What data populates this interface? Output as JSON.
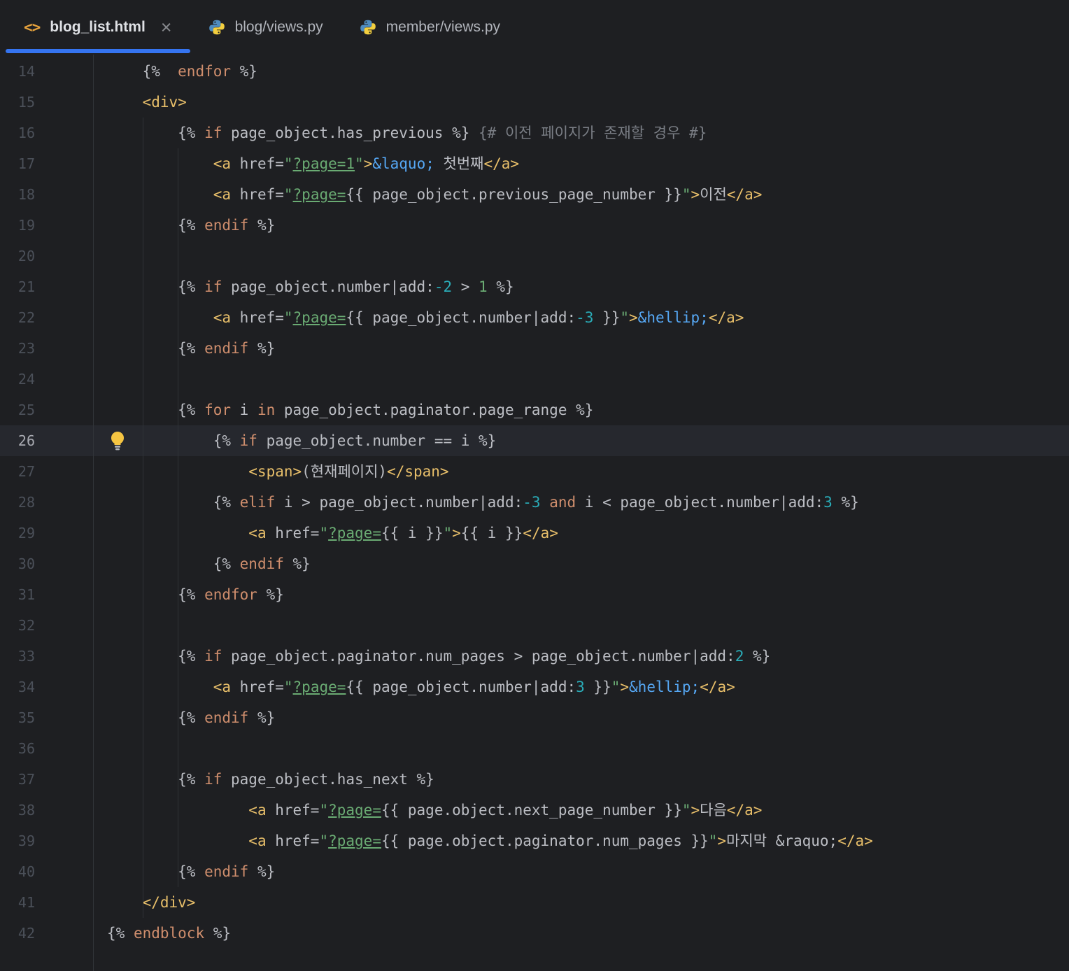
{
  "colors": {
    "bg": "#1e1f22",
    "accent": "#3574f0",
    "current_line": "#26282e",
    "gutter_line": "#313438",
    "indent_guide": "#2f3237",
    "line_number": "#4b5059",
    "line_number_active": "#a9abb2",
    "plain": "#bcbec4",
    "keyword": "#cf8e6d",
    "tag": "#e8bf6a",
    "string": "#6aab73",
    "entity": "#56a8f5",
    "number": "#2aacb8",
    "comment": "#7a7e85",
    "tab_active": "#dfe1e5",
    "tab_inactive": "#b2b5bc",
    "close_icon": "#87898e",
    "html_icon": "#e8a33d",
    "bulb": "#f5c542"
  },
  "icons": {
    "html_glyph": "<>",
    "close_glyph": "×"
  },
  "tabs": [
    {
      "label": "blog_list.html",
      "icon": "html",
      "active": true
    },
    {
      "label": "blog/views.py",
      "icon": "python",
      "active": false
    },
    {
      "label": "member/views.py",
      "icon": "python",
      "active": false
    }
  ],
  "editor": {
    "current_line": 26,
    "lines": [
      {
        "n": 14,
        "tokens": [
          [
            "    {%  ",
            "p"
          ],
          [
            "endfor",
            "k"
          ],
          [
            " %}",
            "p"
          ]
        ]
      },
      {
        "n": 15,
        "tokens": [
          [
            "    ",
            "p"
          ],
          [
            "<div>",
            "t"
          ]
        ]
      },
      {
        "n": 16,
        "tokens": [
          [
            "        {% ",
            "p"
          ],
          [
            "if",
            "k"
          ],
          [
            " page_object.has_previous %} ",
            "p"
          ],
          [
            "{# 이전 페이지가 존재할 경우 #}",
            "c"
          ]
        ]
      },
      {
        "n": 17,
        "tokens": [
          [
            "            ",
            "p"
          ],
          [
            "<a",
            "t"
          ],
          [
            " href=",
            "p"
          ],
          [
            "\"",
            "s"
          ],
          [
            "?page=1",
            "u"
          ],
          [
            "\"",
            "s"
          ],
          [
            ">",
            "t"
          ],
          [
            "&laquo;",
            "e"
          ],
          [
            " 첫번째",
            "p"
          ],
          [
            "</a>",
            "t"
          ]
        ]
      },
      {
        "n": 18,
        "tokens": [
          [
            "            ",
            "p"
          ],
          [
            "<a",
            "t"
          ],
          [
            " href=",
            "p"
          ],
          [
            "\"",
            "s"
          ],
          [
            "?page=",
            "u"
          ],
          [
            "{{ page_object.previous_page_number }}",
            "p"
          ],
          [
            "\"",
            "s"
          ],
          [
            ">",
            "t"
          ],
          [
            "이전",
            "p"
          ],
          [
            "</a>",
            "t"
          ]
        ]
      },
      {
        "n": 19,
        "tokens": [
          [
            "        {% ",
            "p"
          ],
          [
            "endif",
            "k"
          ],
          [
            " %}",
            "p"
          ]
        ]
      },
      {
        "n": 20,
        "tokens": []
      },
      {
        "n": 21,
        "tokens": [
          [
            "        {% ",
            "p"
          ],
          [
            "if",
            "k"
          ],
          [
            " page_object.number|add:",
            "p"
          ],
          [
            "-2",
            "n"
          ],
          [
            " > ",
            "p"
          ],
          [
            "1",
            "g"
          ],
          [
            " %}",
            "p"
          ]
        ]
      },
      {
        "n": 22,
        "tokens": [
          [
            "            ",
            "p"
          ],
          [
            "<a",
            "t"
          ],
          [
            " href=",
            "p"
          ],
          [
            "\"",
            "s"
          ],
          [
            "?page=",
            "u"
          ],
          [
            "{{ page_object.number|add:",
            "p"
          ],
          [
            "-3",
            "n"
          ],
          [
            " }}",
            "p"
          ],
          [
            "\"",
            "s"
          ],
          [
            ">",
            "t"
          ],
          [
            "&hellip;",
            "e"
          ],
          [
            "</a>",
            "t"
          ]
        ]
      },
      {
        "n": 23,
        "tokens": [
          [
            "        {% ",
            "p"
          ],
          [
            "endif",
            "k"
          ],
          [
            " %}",
            "p"
          ]
        ]
      },
      {
        "n": 24,
        "tokens": []
      },
      {
        "n": 25,
        "tokens": [
          [
            "        {% ",
            "p"
          ],
          [
            "for",
            "k"
          ],
          [
            " i ",
            "p"
          ],
          [
            "in",
            "k"
          ],
          [
            " page_object.paginator.page_range %}",
            "p"
          ]
        ]
      },
      {
        "n": 26,
        "tokens": [
          [
            "            {% ",
            "p"
          ],
          [
            "if",
            "k"
          ],
          [
            " page_object.number == i %}",
            "p"
          ]
        ]
      },
      {
        "n": 27,
        "tokens": [
          [
            "                ",
            "p"
          ],
          [
            "<span>",
            "t"
          ],
          [
            "(현재페이지)",
            "p"
          ],
          [
            "</span>",
            "t"
          ]
        ]
      },
      {
        "n": 28,
        "tokens": [
          [
            "            {% ",
            "p"
          ],
          [
            "elif",
            "k"
          ],
          [
            " i > page_object.number|add:",
            "p"
          ],
          [
            "-3",
            "n"
          ],
          [
            " ",
            "p"
          ],
          [
            "and",
            "k"
          ],
          [
            " i < page_object.number|add:",
            "p"
          ],
          [
            "3",
            "n"
          ],
          [
            " %}",
            "p"
          ]
        ]
      },
      {
        "n": 29,
        "tokens": [
          [
            "                ",
            "p"
          ],
          [
            "<a",
            "t"
          ],
          [
            " href=",
            "p"
          ],
          [
            "\"",
            "s"
          ],
          [
            "?page=",
            "u"
          ],
          [
            "{{ i }}",
            "p"
          ],
          [
            "\"",
            "s"
          ],
          [
            ">",
            "t"
          ],
          [
            "{{ i }}",
            "p"
          ],
          [
            "</a>",
            "t"
          ]
        ]
      },
      {
        "n": 30,
        "tokens": [
          [
            "            {% ",
            "p"
          ],
          [
            "endif",
            "k"
          ],
          [
            " %}",
            "p"
          ]
        ]
      },
      {
        "n": 31,
        "tokens": [
          [
            "        {% ",
            "p"
          ],
          [
            "endfor",
            "k"
          ],
          [
            " %}",
            "p"
          ]
        ]
      },
      {
        "n": 32,
        "tokens": []
      },
      {
        "n": 33,
        "tokens": [
          [
            "        {% ",
            "p"
          ],
          [
            "if",
            "k"
          ],
          [
            " page_object.paginator.num_pages > page_object.number|add:",
            "p"
          ],
          [
            "2",
            "n"
          ],
          [
            " %}",
            "p"
          ]
        ]
      },
      {
        "n": 34,
        "tokens": [
          [
            "            ",
            "p"
          ],
          [
            "<a",
            "t"
          ],
          [
            " href=",
            "p"
          ],
          [
            "\"",
            "s"
          ],
          [
            "?page=",
            "u"
          ],
          [
            "{{ page_object.number|add:",
            "p"
          ],
          [
            "3",
            "n"
          ],
          [
            " }}",
            "p"
          ],
          [
            "\"",
            "s"
          ],
          [
            ">",
            "t"
          ],
          [
            "&hellip;",
            "e"
          ],
          [
            "</a>",
            "t"
          ]
        ]
      },
      {
        "n": 35,
        "tokens": [
          [
            "        {% ",
            "p"
          ],
          [
            "endif",
            "k"
          ],
          [
            " %}",
            "p"
          ]
        ]
      },
      {
        "n": 36,
        "tokens": []
      },
      {
        "n": 37,
        "tokens": [
          [
            "        {% ",
            "p"
          ],
          [
            "if",
            "k"
          ],
          [
            " page_object.has_next %}",
            "p"
          ]
        ]
      },
      {
        "n": 38,
        "tokens": [
          [
            "                ",
            "p"
          ],
          [
            "<a",
            "t"
          ],
          [
            " href=",
            "p"
          ],
          [
            "\"",
            "s"
          ],
          [
            "?page=",
            "u"
          ],
          [
            "{{ page.object.next_page_number }}",
            "p"
          ],
          [
            "\"",
            "s"
          ],
          [
            ">",
            "t"
          ],
          [
            "다음",
            "p"
          ],
          [
            "</a>",
            "t"
          ]
        ]
      },
      {
        "n": 39,
        "tokens": [
          [
            "                ",
            "p"
          ],
          [
            "<a",
            "t"
          ],
          [
            " href=",
            "p"
          ],
          [
            "\"",
            "s"
          ],
          [
            "?page=",
            "u"
          ],
          [
            "{{ page.object.paginator.num_pages }}",
            "p"
          ],
          [
            "\"",
            "s"
          ],
          [
            ">",
            "t"
          ],
          [
            "마지막 &raquo;",
            "p"
          ],
          [
            "</a>",
            "t"
          ]
        ]
      },
      {
        "n": 40,
        "tokens": [
          [
            "        {% ",
            "p"
          ],
          [
            "endif",
            "k"
          ],
          [
            " %}",
            "p"
          ]
        ]
      },
      {
        "n": 41,
        "tokens": [
          [
            "    ",
            "p"
          ],
          [
            "</div>",
            "t"
          ]
        ]
      },
      {
        "n": 42,
        "tokens": [
          [
            "{% ",
            "p"
          ],
          [
            "endblock",
            "k"
          ],
          [
            " %}",
            "p"
          ]
        ]
      }
    ]
  }
}
